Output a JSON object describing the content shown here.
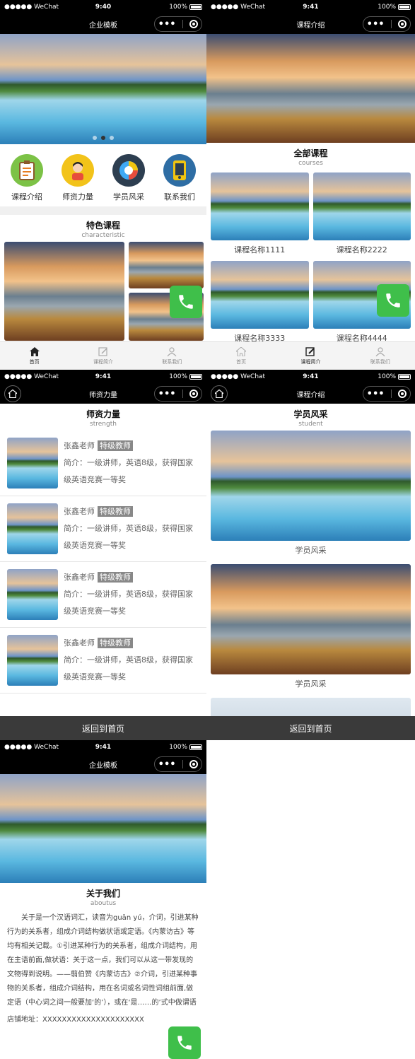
{
  "status": {
    "carrier": "●●●●● WeChat",
    "battery": "100%"
  },
  "s1": {
    "time": "9:40",
    "title": "企业模板",
    "icons": [
      {
        "label": "课程介绍",
        "icon": "clipboard-icon",
        "color": "#7cc246"
      },
      {
        "label": "师资力量",
        "icon": "teacher-icon",
        "color": "#f2c31a"
      },
      {
        "label": "学员风采",
        "icon": "pie-chart-icon",
        "color": "#2d3e50"
      },
      {
        "label": "联系我们",
        "icon": "phone-icon",
        "color": "#2e6da4"
      }
    ],
    "section": {
      "zh": "特色课程",
      "en": "characteristic"
    },
    "tabs": [
      {
        "label": "首页"
      },
      {
        "label": "课程简介"
      },
      {
        "label": "联系我们"
      }
    ]
  },
  "s2": {
    "time": "9:41",
    "title": "课程介绍",
    "section": {
      "zh": "全部课程",
      "en": "courses"
    },
    "courses": [
      "课程名称1111",
      "课程名称2222",
      "课程名称3333",
      "课程名称4444"
    ],
    "tabs": [
      {
        "label": "首页"
      },
      {
        "label": "课程简介"
      },
      {
        "label": "联系我们"
      }
    ]
  },
  "s3": {
    "time": "9:41",
    "title": "师资力量",
    "section": {
      "zh": "师资力量",
      "en": "strength"
    },
    "teachers": [
      {
        "name": "张鑫老师",
        "badge": "特级教师",
        "intro": "简介：一级讲师，英语8级，获得国家级英语竞赛一等奖"
      },
      {
        "name": "张鑫老师",
        "badge": "特级教师",
        "intro": "简介：一级讲师，英语8级，获得国家级英语竞赛一等奖"
      },
      {
        "name": "张鑫老师",
        "badge": "特级教师",
        "intro": "简介：一级讲师，英语8级，获得国家级英语竞赛一等奖"
      },
      {
        "name": "张鑫老师",
        "badge": "特级教师",
        "intro": "简介：一级讲师，英语8级，获得国家级英语竞赛一等奖"
      }
    ],
    "back": "返回到首页"
  },
  "s4": {
    "time": "9:41",
    "title": "课程介绍",
    "section": {
      "zh": "学员风采",
      "en": "student"
    },
    "students": [
      "学员风采",
      "学员风采"
    ],
    "back": "返回到首页"
  },
  "s5": {
    "time": "9:41",
    "title": "企业模板",
    "section": {
      "zh": "关于我们",
      "en": "aboutus"
    },
    "about": "关于是一个汉语词汇，读音为guān yú，介词，引进某种行为的关系者，组成介词结构做状语或定语。《内蒙访古》等均有相关记载。①引进某种行为的关系者，组成介词结构，用在主语前面,做状语：关于这一点，我们可以从这一带发现的文物得到说明。——翦伯赞《内蒙访古》②介词，引进某种事物的关系者，组成介词结构，用在名词或名词性词组前面,做定语（中心词之间一般要加‘的’），或在‘是……的’式中做谓语",
    "address": "店铺地址：XXXXXXXXXXXXXXXXXXXXX"
  }
}
